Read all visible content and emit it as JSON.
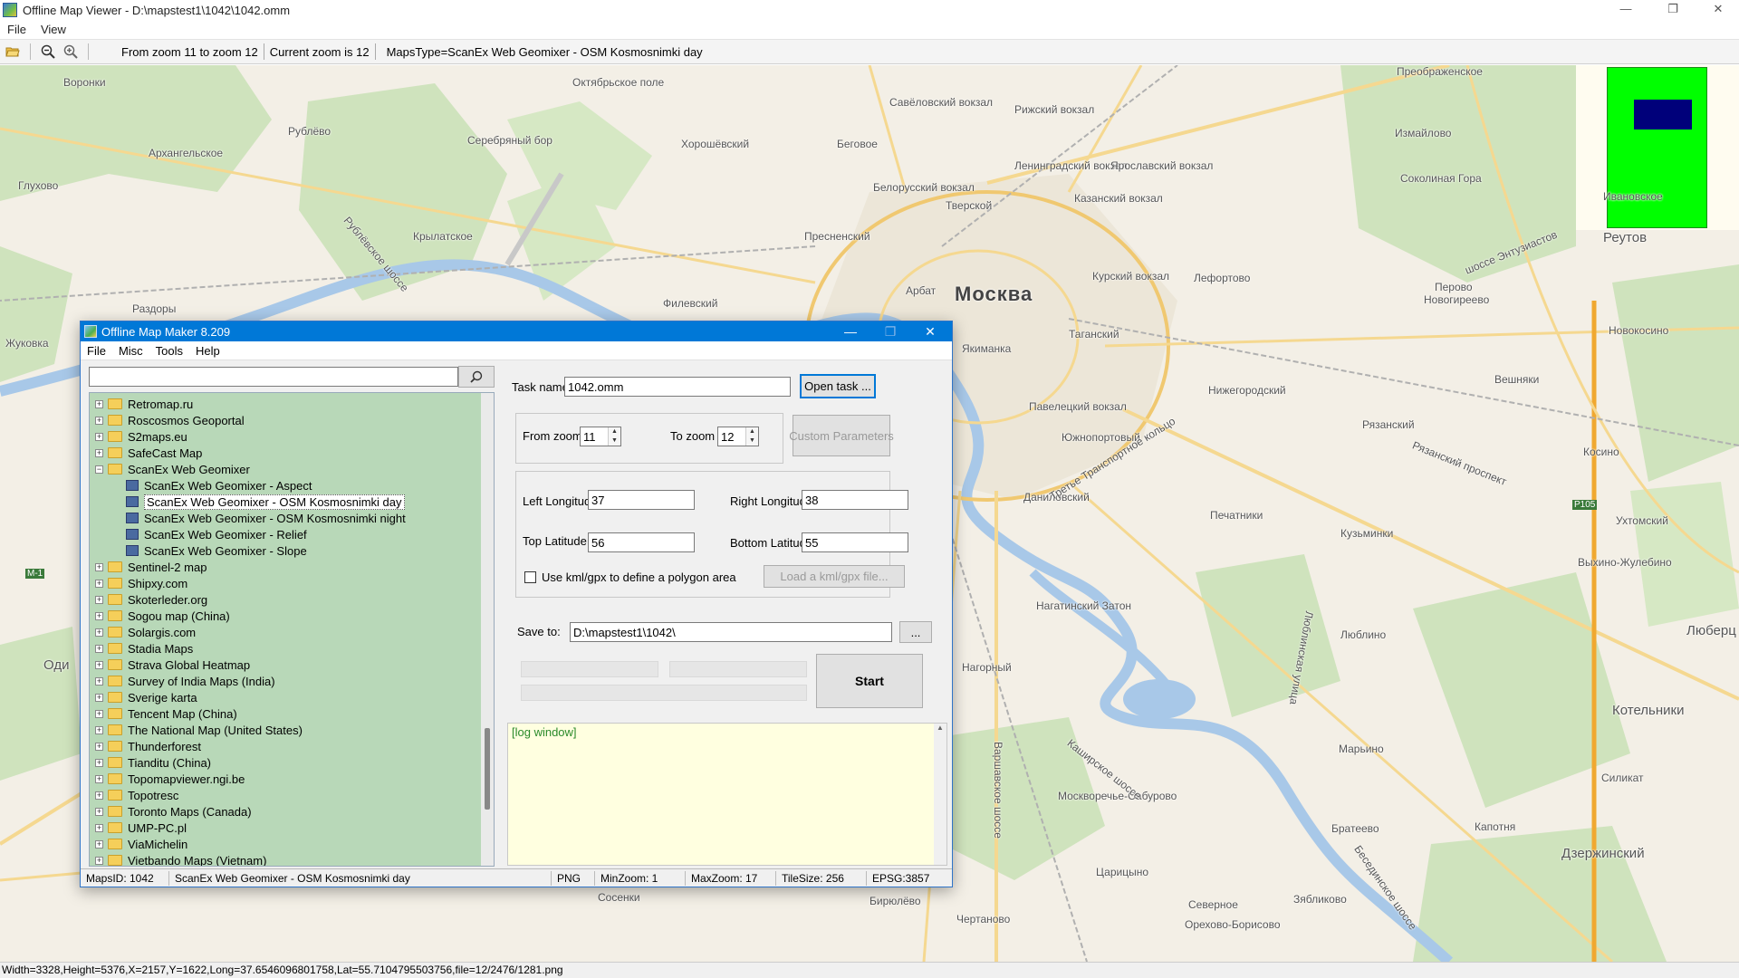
{
  "window": {
    "title": "Offline Map Viewer - D:\\mapstest1\\1042\\1042.omm",
    "controls": {
      "minimize": "—",
      "maximize": "❐",
      "close": "✕"
    }
  },
  "menu": [
    "File",
    "View"
  ],
  "toolbar": {
    "zoom_range": "From zoom 11 to zoom 12",
    "current_zoom": "Current zoom is 12",
    "maps_type": "MapsType=ScanEx Web Geomixer - OSM Kosmosnimki day"
  },
  "map": {
    "labels": {
      "moskva": "Москва",
      "reutov": "Реутов",
      "lubertsy": "Люберц",
      "dzerzhinsky": "Дзержинский",
      "kotelniki": "Котельники",
      "odi": "Оди",
      "oktyabrskoe": "Октябрьское поле",
      "preobrazhenskoe": "Преображенское",
      "izmaylovo": "Измайлово",
      "sokolinaya": "Соколиная Гора",
      "lefortovo": "Лефортово",
      "nizhegorodsky": "Нижегородский",
      "ryazansky": "Рязанский",
      "kuzminki": "Кузьминки",
      "pechatniki": "Печатники",
      "lyublino": "Люблино",
      "maryino": "Марьино",
      "bratevo": "Братеево",
      "kapotnya": "Капотня",
      "nagatinsky": "Нагатинский Затон",
      "danilovsky": "Даниловский",
      "yuzhnoportovy": "Южнопортовый",
      "taganskiy": "Таганский",
      "yakimanka": "Якиманка",
      "arbat": "Арбат",
      "presnensky": "Пресненский",
      "khoroshevsky": "Хорошёвский",
      "tverskoy": "Тверской",
      "begovoe": "Беговое",
      "krylatskoe": "Крылатское",
      "serebryany": "Серебряный бор",
      "filevsky": "Филевский",
      "moskvorechye": "Москворечье-Сабурово",
      "tsaritsyno": "Царицыно",
      "nagornyy": "Нагорный",
      "vykhino": "Выхино-Жулебино",
      "novogireevo": "Новогиреево",
      "perovo": "Перово",
      "veshnyaki": "Вешняки",
      "kosino": "Косино",
      "ukhtomsky": "Ухтомский",
      "novokosino": "Новокосино",
      "ivanovskoe": "Ивановское",
      "rublevo": "Рублёво",
      "glukhovo": "Глухово",
      "razdory": "Раздоры",
      "zhukovka": "Жуковка",
      "voronki": "Воронки",
      "arkhangelskoe": "Архангельское",
      "leningradsky": "Ленинградский вокзал",
      "kazansky": "Казанский вокзал",
      "kursky": "Курский вокзал",
      "paveletsky": "Павелецкий вокзал",
      "belorussky": "Белорусский вокзал",
      "rizhsky": "Рижский вокзал",
      "savelovsky": "Савёловский вокзал",
      "yaroslavsky": "Ярославский вокзал",
      "ttk": "Третье Транспортное кольцо",
      "ryazansky_pr": "Рязанский проспект",
      "entuziastov": "шоссе Энтузиастов",
      "rublevskoe": "Рублёвское шоссе",
      "kashirskoe": "Каширское шоссе",
      "varshavskoe": "Варшавское шоссе",
      "lyublinskaya": "Люблинская улица",
      "besedinskoe": "Бесединское шоссе",
      "m1": "М-1",
      "p105": "Р105",
      "silikat": "Силикат",
      "orekhovo": "Орехово-Борисово",
      "severnoe": "Северное",
      "zyablikovo": "Зябликово",
      "chertanovo": "Чертаново",
      "biryulevo": "Бирюлёво",
      "sosenki": "Сосенки"
    }
  },
  "statusbar": "Width=3328,Height=5376,X=2157,Y=1622,Long=37.6546096801758,Lat=55.7104795503756,file=12/2476/1281.png",
  "dialog": {
    "title": "Offline Map Maker 8.209",
    "menu": [
      "File",
      "Misc",
      "Tools",
      "Help"
    ],
    "search": {
      "value": "",
      "placeholder": ""
    },
    "tree": [
      {
        "label": "Retromap.ru",
        "level": 0,
        "expanded": false
      },
      {
        "label": "Roscosmos Geoportal",
        "level": 0,
        "expanded": false
      },
      {
        "label": "S2maps.eu",
        "level": 0,
        "expanded": false
      },
      {
        "label": "SafeCast Map",
        "level": 0,
        "expanded": false
      },
      {
        "label": "ScanEx Web Geomixer",
        "level": 0,
        "expanded": true
      },
      {
        "label": "ScanEx Web Geomixer - Aspect",
        "level": 1
      },
      {
        "label": "ScanEx Web Geomixer - OSM Kosmosnimki day",
        "level": 1,
        "selected": true
      },
      {
        "label": "ScanEx Web Geomixer - OSM Kosmosnimki night",
        "level": 1
      },
      {
        "label": "ScanEx Web Geomixer - Relief",
        "level": 1
      },
      {
        "label": "ScanEx Web Geomixer - Slope",
        "level": 1
      },
      {
        "label": "Sentinel-2 map",
        "level": 0,
        "expanded": false
      },
      {
        "label": "Shipxy.com",
        "level": 0,
        "expanded": false
      },
      {
        "label": "Skoterleder.org",
        "level": 0,
        "expanded": false
      },
      {
        "label": "Sogou map (China)",
        "level": 0,
        "expanded": false
      },
      {
        "label": "Solargis.com",
        "level": 0,
        "expanded": false
      },
      {
        "label": "Stadia Maps",
        "level": 0,
        "expanded": false
      },
      {
        "label": "Strava Global Heatmap",
        "level": 0,
        "expanded": false
      },
      {
        "label": "Survey of India Maps (India)",
        "level": 0,
        "expanded": false
      },
      {
        "label": "Sverige karta",
        "level": 0,
        "expanded": false
      },
      {
        "label": "Tencent Map (China)",
        "level": 0,
        "expanded": false
      },
      {
        "label": "The National Map (United States)",
        "level": 0,
        "expanded": false
      },
      {
        "label": "Thunderforest",
        "level": 0,
        "expanded": false
      },
      {
        "label": "Tianditu (China)",
        "level": 0,
        "expanded": false
      },
      {
        "label": "Topomapviewer.ngi.be",
        "level": 0,
        "expanded": false
      },
      {
        "label": "Topotresc",
        "level": 0,
        "expanded": false
      },
      {
        "label": "Toronto Maps (Canada)",
        "level": 0,
        "expanded": false
      },
      {
        "label": "UMP-PC.pl",
        "level": 0,
        "expanded": false
      },
      {
        "label": "ViaMichelin",
        "level": 0,
        "expanded": false
      },
      {
        "label": "Vietbando Maps (Vietnam)",
        "level": 0,
        "expanded": false
      }
    ],
    "task_name_label": "Task name",
    "task_name_value": "1042.omm",
    "open_task_label": "Open task ...",
    "from_zoom_label": "From zoom",
    "from_zoom_value": "11",
    "to_zoom_label": "To zoom",
    "to_zoom_value": "12",
    "custom_params_label": "Custom Parameters",
    "left_lon_label": "Left Longitude",
    "left_lon_value": "37",
    "right_lon_label": "Right Longitude",
    "right_lon_value": "38",
    "top_lat_label": "Top Latitude",
    "top_lat_value": "56",
    "bottom_lat_label": "Bottom Latitude",
    "bottom_lat_value": "55",
    "kml_checkbox_label": "Use kml/gpx to define a polygon area",
    "load_kml_label": "Load a kml/gpx file...",
    "save_to_label": "Save to:",
    "save_to_value": "D:\\mapstest1\\1042\\",
    "browse_label": "...",
    "start_label": "Start",
    "log_text": "[log window]",
    "status": {
      "maps_id": "MapsID: 1042",
      "maps_name": "ScanEx Web Geomixer - OSM Kosmosnimki day",
      "format": "PNG",
      "min_zoom": "MinZoom: 1",
      "max_zoom": "MaxZoom: 17",
      "tile_size": "TileSize: 256",
      "epsg": "EPSG:3857"
    }
  }
}
